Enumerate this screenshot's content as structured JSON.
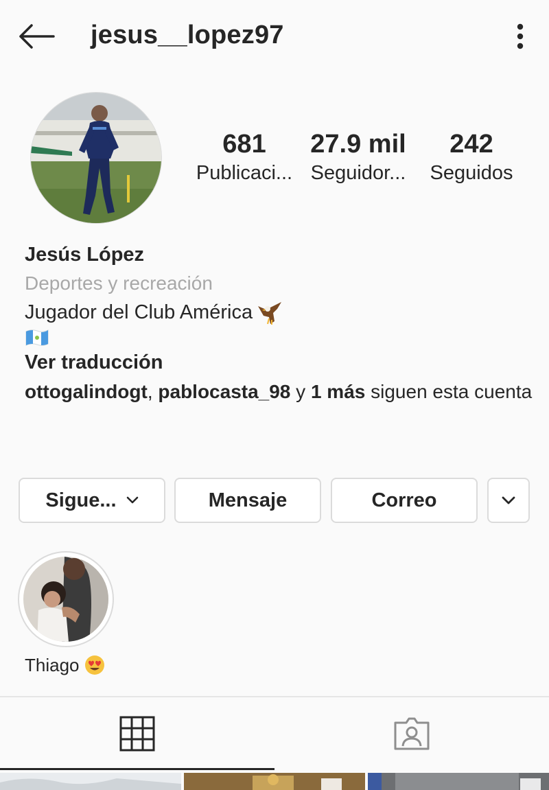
{
  "header": {
    "username": "jesus__lopez97",
    "back_icon": "arrow-left-icon",
    "more_icon": "more-vertical-icon"
  },
  "stats": {
    "posts": {
      "value": "681",
      "label": "Publicaci..."
    },
    "followers": {
      "value": "27.9 mil",
      "label": "Seguidor..."
    },
    "following": {
      "value": "242",
      "label": "Seguidos"
    }
  },
  "bio": {
    "name": "Jesús López",
    "category": "Deportes y recreación",
    "line1": "Jugador del Club América",
    "line1_icon": "eagle-emoji",
    "line2_icon": "guatemala-flag-emoji",
    "see_translation": "Ver traducción",
    "followed_by": {
      "user1": "ottogalindogt",
      "separator": ", ",
      "user2": "pablocasta_98",
      "and": " y ",
      "more": "1 más",
      "suffix": " siguen esta cuenta"
    }
  },
  "actions": {
    "following_label": "Sigue...",
    "message_label": "Mensaje",
    "email_label": "Correo"
  },
  "highlights": [
    {
      "label": "Thiago",
      "emoji_icon": "heart-eyes-emoji"
    }
  ],
  "tabs": {
    "grid_icon": "grid-icon",
    "tagged_icon": "tagged-person-icon",
    "active": "grid"
  },
  "colors": {
    "text": "#262626",
    "muted": "#a8a8a8",
    "border": "#dbdbdb",
    "background": "#fafafa"
  }
}
